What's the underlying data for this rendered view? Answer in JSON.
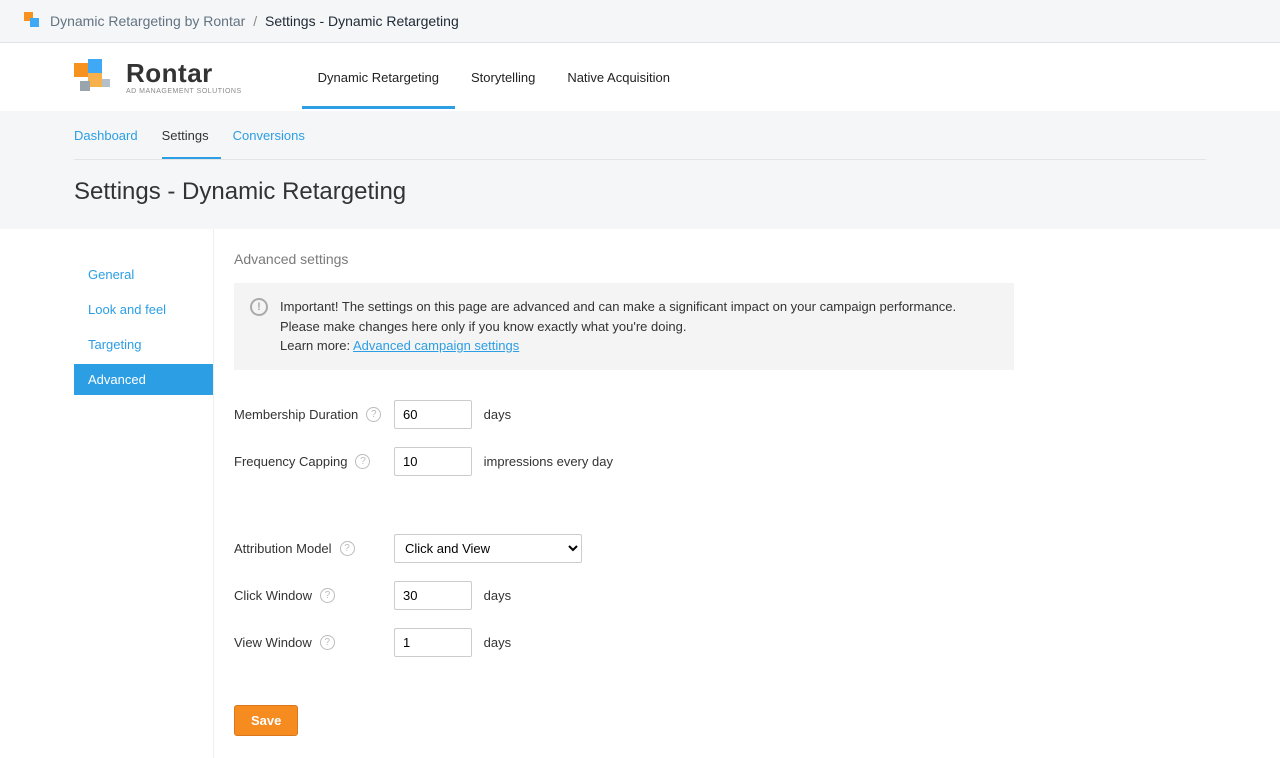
{
  "breadcrumb": {
    "app": "Dynamic Retargeting by Rontar",
    "current": "Settings - Dynamic Retargeting"
  },
  "logo": {
    "name": "Rontar",
    "tag": "AD MANAGEMENT SOLUTIONS"
  },
  "mainNav": {
    "items": [
      "Dynamic Retargeting",
      "Storytelling",
      "Native Acquisition"
    ],
    "active": 0
  },
  "subNav": {
    "items": [
      "Dashboard",
      "Settings",
      "Conversions"
    ],
    "active": 1
  },
  "pageTitle": "Settings - Dynamic Retargeting",
  "sidebar": {
    "items": [
      "General",
      "Look and feel",
      "Targeting",
      "Advanced"
    ],
    "active": 3
  },
  "section": {
    "title": "Advanced settings"
  },
  "notice": {
    "text": "Important! The settings on this page are advanced and can make a significant impact on your campaign performance. Please make changes here only if you know exactly what you're doing.",
    "learnMorePrefix": "Learn more: ",
    "linkLabel": "Advanced campaign settings"
  },
  "form": {
    "membership": {
      "label": "Membership Duration",
      "value": "60",
      "suffix": "days"
    },
    "frequency": {
      "label": "Frequency Capping",
      "value": "10",
      "suffix": "impressions every day"
    },
    "attribution": {
      "label": "Attribution Model",
      "selected": "Click and View",
      "options": [
        "Click and View"
      ]
    },
    "clickWindow": {
      "label": "Click Window",
      "value": "30",
      "suffix": "days"
    },
    "viewWindow": {
      "label": "View Window",
      "value": "1",
      "suffix": "days"
    }
  },
  "buttons": {
    "save": "Save"
  }
}
